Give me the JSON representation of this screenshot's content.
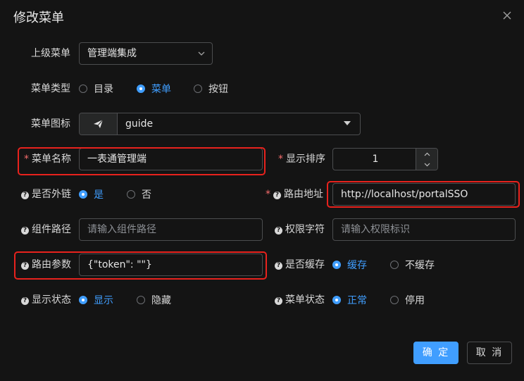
{
  "dialog": {
    "title": "修改菜单"
  },
  "form": {
    "parent_menu": {
      "label": "上级菜单",
      "value": "管理端集成"
    },
    "menu_type": {
      "label": "菜单类型",
      "options": [
        "目录",
        "菜单",
        "按钮"
      ],
      "selected": "菜单"
    },
    "menu_icon": {
      "label": "菜单图标",
      "value": "guide"
    },
    "menu_name": {
      "label": "菜单名称",
      "required_mark": "*",
      "value": "一表通管理端"
    },
    "display_order": {
      "label": "显示排序",
      "required_mark": "*",
      "value": "1"
    },
    "is_external": {
      "label": "是否外链",
      "options": [
        "是",
        "否"
      ],
      "selected": "是"
    },
    "route_path": {
      "label": "路由地址",
      "required_mark": "*",
      "value": "http://localhost/portalSSO"
    },
    "component_path": {
      "label": "组件路径",
      "placeholder": "请输入组件路径"
    },
    "permission": {
      "label": "权限字符",
      "placeholder": "请输入权限标识"
    },
    "route_params": {
      "label": "路由参数",
      "value": "{\"token\": \"\"}"
    },
    "is_cache": {
      "label": "是否缓存",
      "options": [
        "缓存",
        "不缓存"
      ],
      "selected": "缓存"
    },
    "visible": {
      "label": "显示状态",
      "options": [
        "显示",
        "隐藏"
      ],
      "selected": "显示"
    },
    "status": {
      "label": "菜单状态",
      "options": [
        "正常",
        "停用"
      ],
      "selected": "正常"
    }
  },
  "footer": {
    "confirm_label": "确 定",
    "cancel_label": "取 消"
  },
  "icons": {
    "help": "?",
    "close": "close-icon",
    "send": "paper-plane-icon"
  },
  "colors": {
    "accent": "#409eff",
    "highlight": "#e8221d",
    "background": "#141414"
  }
}
